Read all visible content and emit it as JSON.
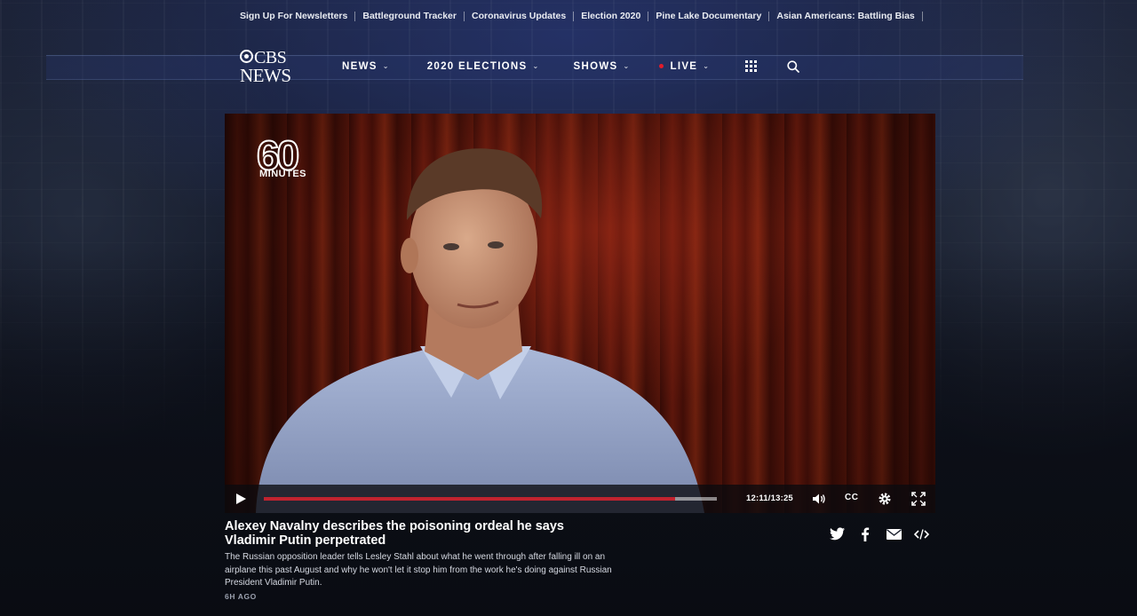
{
  "top_links": [
    "Sign Up For Newsletters",
    "Battleground Tracker",
    "Coronavirus Updates",
    "Election 2020",
    "Pine Lake Documentary",
    "Asian Americans: Battling Bias"
  ],
  "logo": {
    "line1": "CBS",
    "line2": "NEWS"
  },
  "nav": {
    "news": "NEWS",
    "elections": "2020 ELECTIONS",
    "shows": "SHOWS",
    "live": "LIVE",
    "chevron": "⌄",
    "live_dot_color": "#e21b2a"
  },
  "icons": {
    "grid": "grid-icon",
    "search": "search-icon",
    "play": "play-icon",
    "volume": "volume-icon",
    "settings": "gear-icon",
    "fullscreen": "fullscreen-icon",
    "twitter": "twitter-icon",
    "facebook": "facebook-icon",
    "email": "email-icon",
    "embed": "embed-icon"
  },
  "video": {
    "show_logo_number": "60",
    "show_logo_word": "MINUTES",
    "time": "12:11/13:25",
    "progress_fraction": 0.908,
    "cc_label": "CC",
    "progress_color": "#c0232f"
  },
  "story": {
    "headline": "Alexey Navalny describes the poisoning ordeal he says Vladimir Putin perpetrated",
    "description": "The Russian opposition leader tells Lesley Stahl about what he went through after falling ill on an airplane this past August and why he won't let it stop him from the work he's doing against Russian President Vladimir Putin.",
    "age": "6H AGO"
  }
}
